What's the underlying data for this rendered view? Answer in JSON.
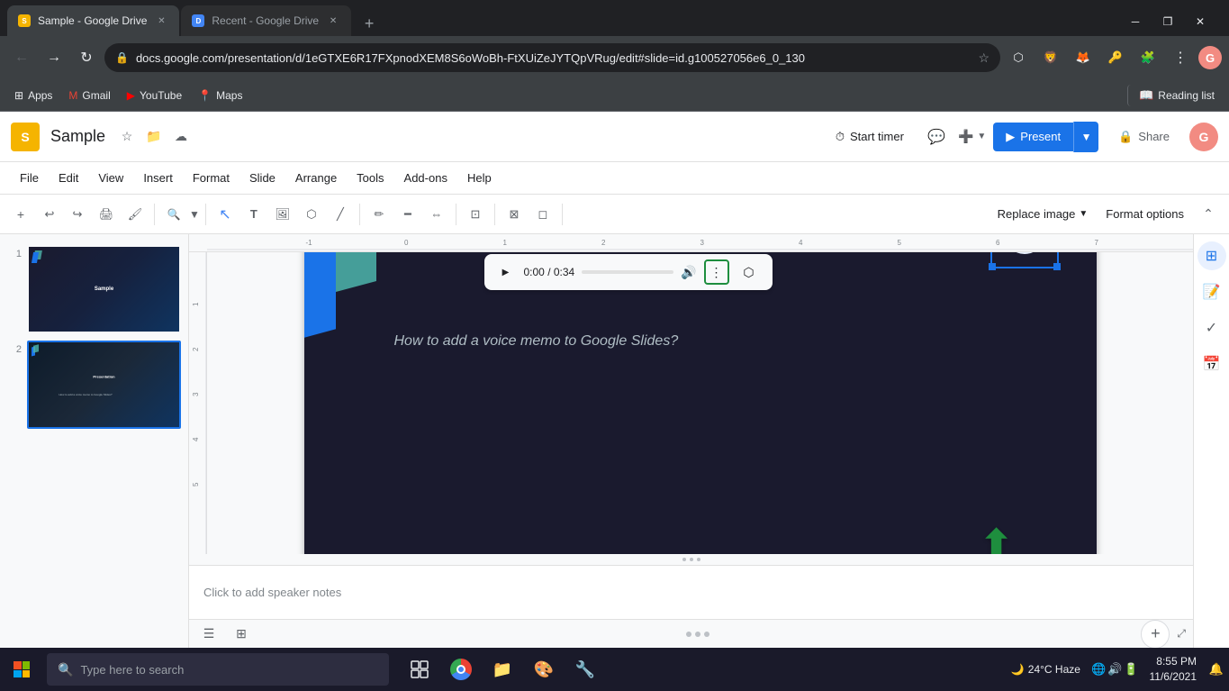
{
  "browser": {
    "tabs": [
      {
        "id": "tab-1",
        "title": "Sample - Google Drive",
        "favicon_color": "#f5b400",
        "active": true
      },
      {
        "id": "tab-2",
        "title": "Recent - Google Drive",
        "favicon_color": "#4285f4",
        "active": false
      }
    ],
    "address": "docs.google.com/presentation/d/1eGTXE6R17FXpnodXEM8S6oWoBh-FtXUiZeJYTQpVRug/edit#slide=id.g100527056e6_0_130",
    "bookmarks": [
      {
        "id": "apps",
        "label": "Apps",
        "favicon_color": "#4285f4"
      },
      {
        "id": "gmail",
        "label": "Gmail",
        "favicon_color": "#ea4335"
      },
      {
        "id": "youtube",
        "label": "YouTube",
        "favicon_color": "#ff0000"
      },
      {
        "id": "maps",
        "label": "Maps",
        "favicon_color": "#34a853"
      }
    ],
    "reading_list_label": "Reading list"
  },
  "app": {
    "title": "Sample",
    "logo_color": "#f5b400",
    "menu_items": [
      "File",
      "Edit",
      "View",
      "Insert",
      "Format",
      "Slide",
      "Arrange",
      "Tools",
      "Add-ons",
      "Help"
    ],
    "header_buttons": {
      "start_timer": "Start timer",
      "present": "Present",
      "share": "Share"
    },
    "toolbar": {
      "replace_image": "Replace image",
      "format_options": "Format options"
    }
  },
  "slides": {
    "slide_1": {
      "num": 1,
      "title": "Sample"
    },
    "slide_2": {
      "num": 2,
      "title": "Presentation",
      "subtitle": "How to add a voice memo to Google Slides?",
      "audio_time": "0:00 / 0:34"
    }
  },
  "speaker_notes": {
    "placeholder": "Click to add speaker notes"
  },
  "taskbar": {
    "search_placeholder": "Type here to search",
    "weather": "24°C  Haze",
    "time": "8:55 PM",
    "date": "11/6/2021"
  }
}
